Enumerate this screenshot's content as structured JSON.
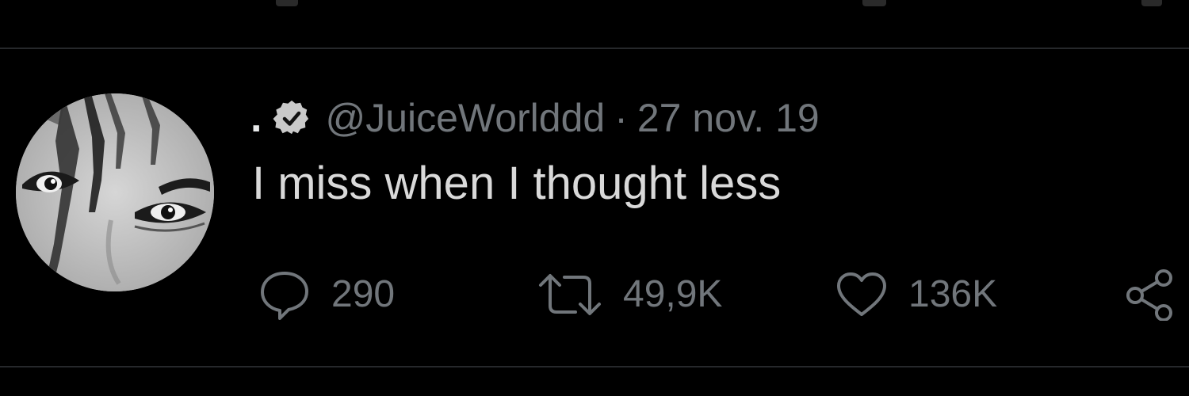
{
  "tweet": {
    "display_name": ".",
    "verified_icon": "verified-badge-icon",
    "handle": "@JuiceWorlddd",
    "separator": "·",
    "date": "27 nov. 19",
    "text": "I miss when I thought less"
  },
  "actions": {
    "reply": {
      "icon": "reply-icon",
      "count": "290"
    },
    "retweet": {
      "icon": "retweet-icon",
      "count": "49,9K"
    },
    "like": {
      "icon": "heart-icon",
      "count": "136K"
    },
    "share": {
      "icon": "share-icon"
    }
  },
  "colors": {
    "background": "#000000",
    "primary_text": "#e7e9ea",
    "secondary_text": "#71767b",
    "divider": "#26282b"
  }
}
